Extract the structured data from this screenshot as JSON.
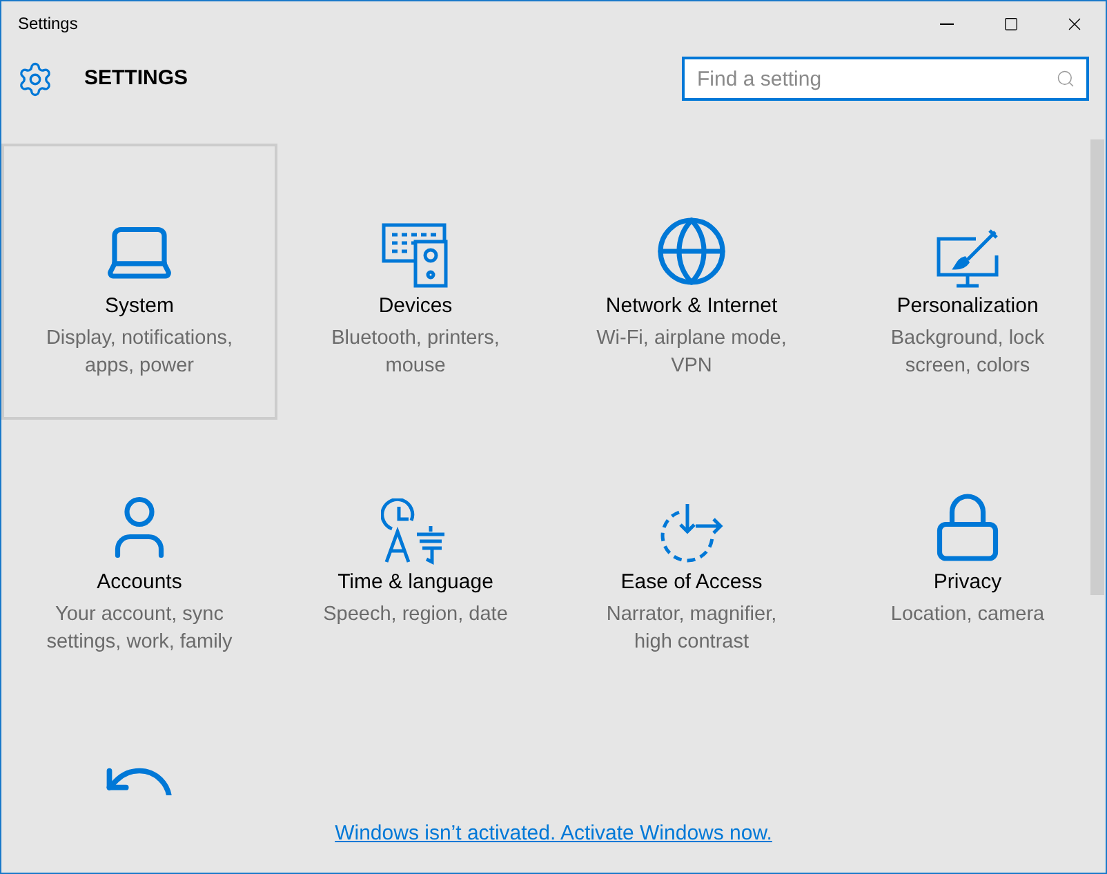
{
  "window": {
    "title": "Settings"
  },
  "header": {
    "title": "SETTINGS"
  },
  "search": {
    "placeholder": "Find a setting"
  },
  "tiles": [
    {
      "title": "System",
      "subtitle": "Display, notifications, apps, power",
      "selected": true
    },
    {
      "title": "Devices",
      "subtitle": "Bluetooth, printers, mouse",
      "selected": false
    },
    {
      "title": "Network & Internet",
      "subtitle": "Wi-Fi, airplane mode, VPN",
      "selected": false
    },
    {
      "title": "Personalization",
      "subtitle": "Background, lock screen, colors",
      "selected": false
    },
    {
      "title": "Accounts",
      "subtitle": "Your account, sync settings, work, family",
      "selected": false
    },
    {
      "title": "Time & language",
      "subtitle": "Speech, region, date",
      "selected": false
    },
    {
      "title": "Ease of Access",
      "subtitle": "Narrator, magnifier, high contrast",
      "selected": false
    },
    {
      "title": "Privacy",
      "subtitle": "Location, camera",
      "selected": false
    },
    {
      "selected": false
    }
  ],
  "activation_link": "Windows isn’t activated. Activate Windows now."
}
